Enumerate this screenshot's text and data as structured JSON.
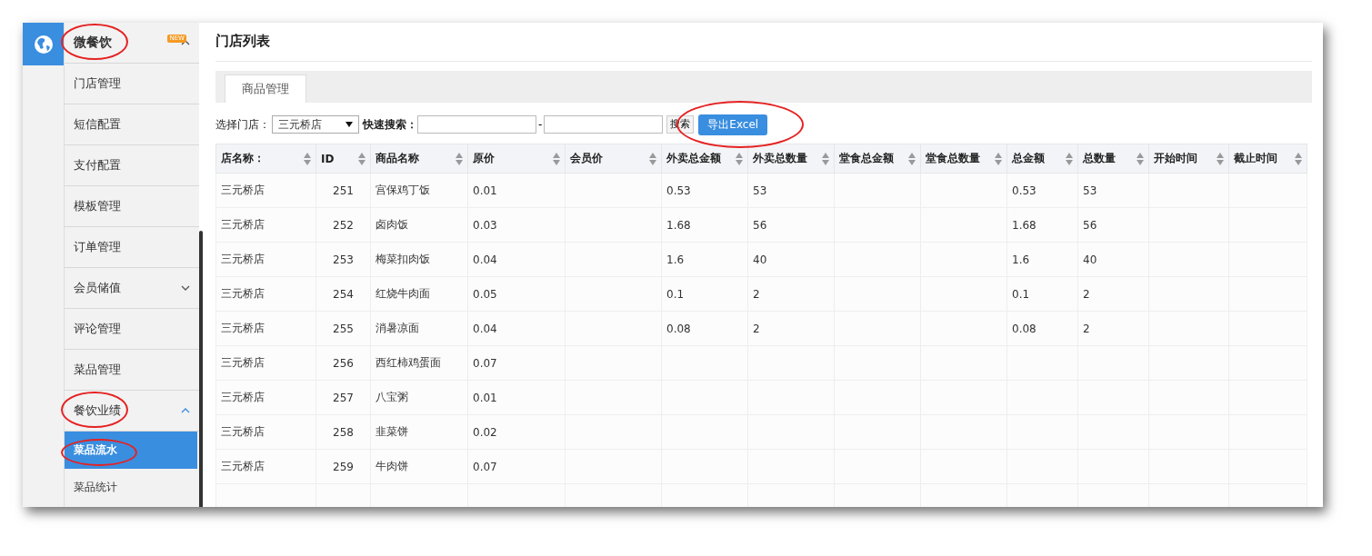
{
  "sidebar": {
    "title": "微餐饮",
    "title_circled": true,
    "badge": "NEW",
    "expanded": true,
    "items": [
      {
        "label": "门店管理"
      },
      {
        "label": "短信配置"
      },
      {
        "label": "支付配置"
      },
      {
        "label": "模板管理"
      },
      {
        "label": "订单管理"
      },
      {
        "label": "会员储值",
        "expanded": false
      },
      {
        "label": "评论管理"
      },
      {
        "label": "菜品管理"
      },
      {
        "label": "餐饮业绩",
        "expanded": true,
        "circled": true,
        "children": [
          {
            "label": "菜品流水",
            "selected": true,
            "circled": true
          },
          {
            "label": "菜品统计",
            "selected": false
          }
        ]
      }
    ]
  },
  "page_title": "门店列表",
  "tabs": [
    {
      "label": "商品管理",
      "selected": true
    }
  ],
  "filters": {
    "store_label": "选择门店：",
    "store_value": "三元桥店",
    "search_label": "快速搜索：",
    "separator": "-",
    "search_button": "搜索",
    "export_button": "导出Excel",
    "export_circled": true
  },
  "table": {
    "columns": [
      "店名称：",
      "ID",
      "商品名称",
      "原价",
      "会员价",
      "外卖总金额",
      "外卖总数量",
      "堂食总金额",
      "堂食总数量",
      "总金额",
      "总数量",
      "开始时间",
      "截止时间"
    ],
    "rows": [
      [
        "三元桥店",
        "251",
        "宫保鸡丁饭",
        "0.01",
        null,
        "0.53",
        "53",
        null,
        null,
        "0.53",
        "53",
        null,
        null
      ],
      [
        "三元桥店",
        "252",
        "卤肉饭",
        "0.03",
        null,
        "1.68",
        "56",
        null,
        null,
        "1.68",
        "56",
        null,
        null
      ],
      [
        "三元桥店",
        "253",
        "梅菜扣肉饭",
        "0.04",
        null,
        "1.6",
        "40",
        null,
        null,
        "1.6",
        "40",
        null,
        null
      ],
      [
        "三元桥店",
        "254",
        "红烧牛肉面",
        "0.05",
        null,
        "0.1",
        "2",
        null,
        null,
        "0.1",
        "2",
        null,
        null
      ],
      [
        "三元桥店",
        "255",
        "消暑凉面",
        "0.04",
        null,
        "0.08",
        "2",
        null,
        null,
        "0.08",
        "2",
        null,
        null
      ],
      [
        "三元桥店",
        "256",
        "西红柿鸡蛋面",
        "0.07",
        null,
        null,
        null,
        null,
        null,
        null,
        null,
        null,
        null
      ],
      [
        "三元桥店",
        "257",
        "八宝粥",
        "0.01",
        null,
        null,
        null,
        null,
        null,
        null,
        null,
        null,
        null
      ],
      [
        "三元桥店",
        "258",
        "韭菜饼",
        "0.02",
        null,
        null,
        null,
        null,
        null,
        null,
        null,
        null,
        null
      ],
      [
        "三元桥店",
        "259",
        "牛肉饼",
        "0.07",
        null,
        null,
        null,
        null,
        null,
        null,
        null,
        null,
        null
      ]
    ]
  }
}
